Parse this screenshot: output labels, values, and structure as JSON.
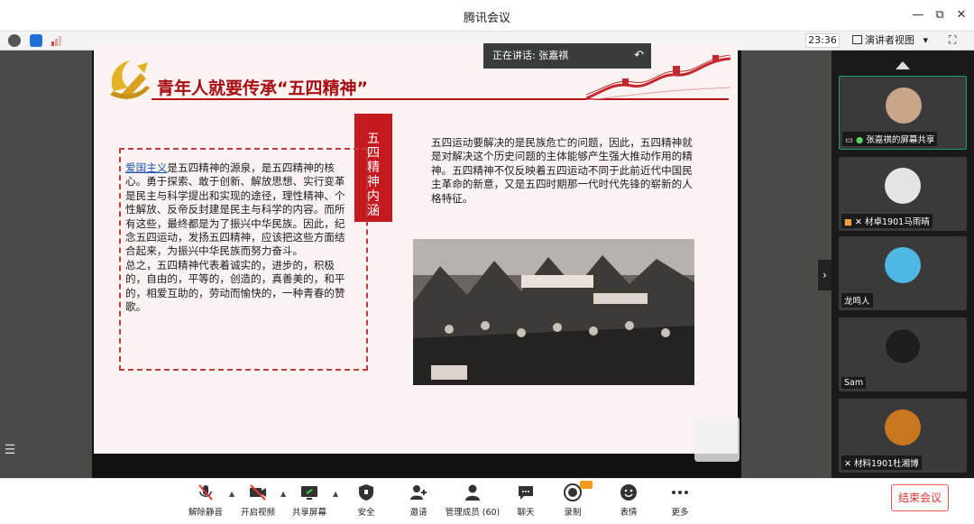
{
  "window": {
    "title": "腾讯会议",
    "minimize": "—",
    "restore": "⧉",
    "close": "✕"
  },
  "infobar": {
    "time": "23:36",
    "view_mode": "演讲者视图",
    "view_caret": "▾",
    "fullscreen": "⛶"
  },
  "speaking": {
    "label": "正在讲话: 张嘉祺"
  },
  "slide": {
    "title": "青年人就要传承“五四精神”",
    "tag": "五四精神内涵",
    "left_highlight": "爱国主义",
    "left_text_1": "是五四精神的源泉，是五四精神的核心。勇于探索、敢于创新、解放思想、实行变革是民主与科学提出和实现的途径，理性精神、个性解放、反帝反封建是民主与科学的内容。而所有这些，最终都是为了振兴中华民族。因此，纪念五四运动，发扬五四精神，应该把这些方面结合起来，为振兴中华民族而努力奋斗。",
    "left_text_2": "总之，五四精神代表着诚实的，进步的，积极的，自由的，平等的，创造的，真善美的，和平的，相爱互助的，劳动而愉快的，一种青春的赞歌。",
    "right_text": "五四运动要解决的是民族危亡的问题，因此，五四精神就是对解决这个历史问题的主体能够产生强大推动作用的精神。五四精神不仅反映着五四运动不同于此前近代中国民主革命的新意，又是五四时期那一代时代先锋的崭新的人格特征。"
  },
  "participants": [
    {
      "name": "张嘉祺的屏幕共享",
      "avatar_color": "#c9a58a"
    },
    {
      "name": "材卓1901马雨晴",
      "avatar_color": "#e4e4e4"
    },
    {
      "name": "龙鸣人",
      "avatar_color": "#4fb7e3"
    },
    {
      "name": "Sam",
      "avatar_color": "#1e1e1e"
    },
    {
      "name": "材料1901杜湘博",
      "avatar_color": "#c8771f"
    }
  ],
  "toolbar": {
    "mute": "解除静音",
    "video": "开启视频",
    "share": "共享屏幕",
    "security": "安全",
    "invite": "邀请",
    "members": "管理成员 (60)",
    "chat": "聊天",
    "record": "录制",
    "reactions": "表情",
    "more": "更多",
    "end": "结束会议"
  },
  "colors": {
    "accent_red": "#c41a1f",
    "end_red": "#d33",
    "dark_bg": "#2f3033"
  }
}
